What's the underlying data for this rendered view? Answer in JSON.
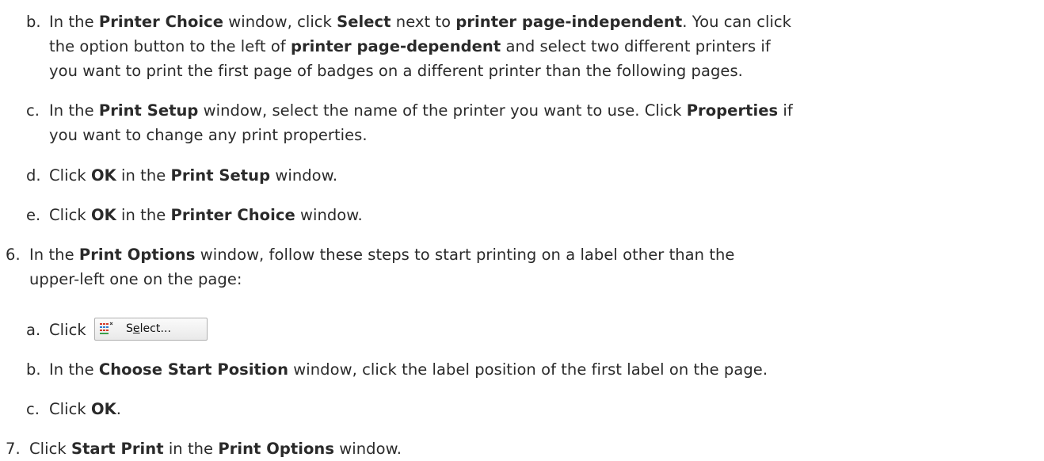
{
  "steps": [
    {
      "marker": "b.",
      "lines": [
        [
          {
            "t": "In the "
          },
          {
            "t": "Printer Choice",
            "b": true
          },
          {
            "t": " window, click "
          },
          {
            "t": "Select",
            "b": true
          },
          {
            "t": " next to "
          },
          {
            "t": "printer page-independent",
            "b": true
          },
          {
            "t": ". You can click"
          }
        ],
        [
          {
            "t": "the option button to the left of "
          },
          {
            "t": "printer page-dependent",
            "b": true
          },
          {
            "t": " and select two different printers if"
          }
        ],
        [
          {
            "t": "you want to print the first page of badges on a different printer than the following pages."
          }
        ]
      ]
    },
    {
      "marker": "c.",
      "lines": [
        [
          {
            "t": "In the "
          },
          {
            "t": "Print Setup",
            "b": true
          },
          {
            "t": " window, select the name of the printer you want to use. Click "
          },
          {
            "t": "Properties",
            "b": true
          },
          {
            "t": " if"
          }
        ],
        [
          {
            "t": "you want to change any print properties."
          }
        ]
      ]
    },
    {
      "marker": "d.",
      "lines": [
        [
          {
            "t": "Click "
          },
          {
            "t": "OK",
            "b": true
          },
          {
            "t": " in the "
          },
          {
            "t": "Print Setup",
            "b": true
          },
          {
            "t": " window."
          }
        ]
      ]
    },
    {
      "marker": "e.",
      "lines": [
        [
          {
            "t": "Click "
          },
          {
            "t": "OK",
            "b": true
          },
          {
            "t": " in the "
          },
          {
            "t": "Printer Choice",
            "b": true
          },
          {
            "t": " window."
          }
        ]
      ]
    },
    {
      "marker": "6.",
      "lines": [
        [
          {
            "t": "In the "
          },
          {
            "t": "Print Options",
            "b": true
          },
          {
            "t": " window, follow these steps to start printing on a label other than the"
          }
        ],
        [
          {
            "t": "upper-left one on the page:"
          }
        ]
      ]
    },
    {
      "marker": "a.",
      "lines": [
        [
          {
            "t": "Click "
          }
        ]
      ]
    },
    {
      "marker": "b.",
      "lines": [
        [
          {
            "t": "In the "
          },
          {
            "t": "Choose Start Position",
            "b": true
          },
          {
            "t": " window, click the label position of the first label on the page."
          }
        ]
      ]
    },
    {
      "marker": "c.",
      "lines": [
        [
          {
            "t": "Click "
          },
          {
            "t": "OK",
            "b": true
          },
          {
            "t": "."
          }
        ]
      ]
    },
    {
      "marker": "7.",
      "lines": [
        [
          {
            "t": "Click "
          },
          {
            "t": "Start Print",
            "b": true
          },
          {
            "t": " in the "
          },
          {
            "t": "Print Options",
            "b": true
          },
          {
            "t": " window."
          }
        ]
      ]
    }
  ],
  "select_button": {
    "label_prefix": "S",
    "label_underlined": "e",
    "label_suffix": "lect...",
    "icon": "grid-list-icon"
  }
}
